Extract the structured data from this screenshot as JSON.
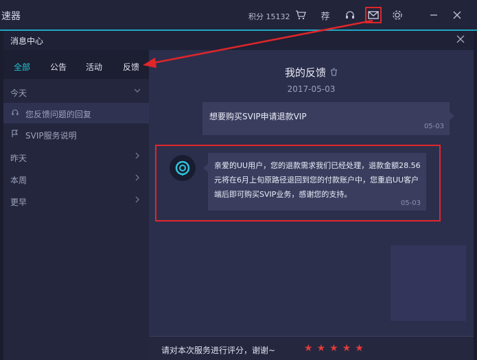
{
  "app": {
    "title": "速器",
    "points_label": "积分 15132",
    "recommend_label": "荐"
  },
  "toolbar_icons": [
    "cart-icon",
    "recommend-icon",
    "headset-icon",
    "mail-icon",
    "gear-icon",
    "minimize-icon",
    "close-icon"
  ],
  "dialog": {
    "title": "消息中心"
  },
  "tabs": [
    {
      "label": "全部",
      "active": true
    },
    {
      "label": "公告",
      "active": false
    },
    {
      "label": "活动",
      "active": false
    },
    {
      "label": "反馈",
      "active": false
    }
  ],
  "tree": {
    "today": "今天",
    "today_items": [
      "您反馈问题的回复",
      "SVIP服务说明"
    ],
    "yesterday": "昨天",
    "this_week": "本周",
    "earlier": "更早"
  },
  "feedback": {
    "title": "我的反馈",
    "date": "2017-05-03",
    "user_message": "想要购买SVIP申请退款VIP",
    "user_time": "05-03",
    "reply_message": "亲爱的UU用户，您的退款需求我们已经处理，退款金额28.56元将在6月上旬原路径退回到您的付款账户中，您重启UU客户端后即可购买SVIP业务，感谢您的支持。",
    "reply_time": "05-03"
  },
  "rating": {
    "prompt": "请对本次服务进行评分，谢谢~",
    "stars": 5
  },
  "colors": {
    "accent": "#1fc8d8",
    "highlight": "#e0262a",
    "star": "#e23b3b"
  }
}
